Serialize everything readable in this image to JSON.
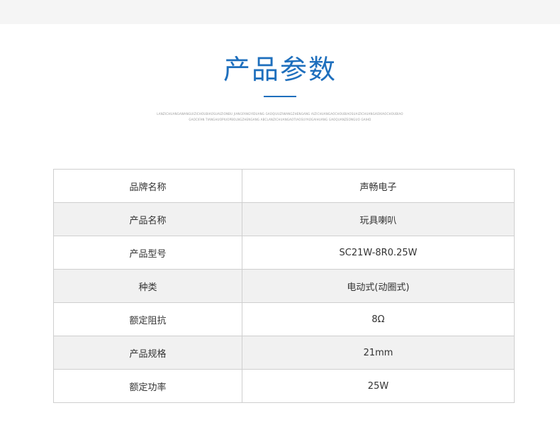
{
  "header": {
    "title": "产品参数",
    "subtitle_line_1": "LANZICHUANGAWANGUIZICHOUBIAOSUAIZIONBU JIANGFANGYIDUANG GAOQIUUZIWANGZHENGANG AIZICHUANGAOCHOUBIAOSUAIZICHUANGAOXIAOCHOUBIAO",
    "subtitle_line_2": "GAOCIFAN TIANGHUOPIUOPBOLNGZHENGANG ABCLANZICHUANGAOTIAOSUYAOGAIHUANG GAOQUANZEONGUO GAIHD"
  },
  "table": {
    "rows": [
      {
        "label": "品牌名称",
        "value": "声畅电子"
      },
      {
        "label": "产品名称",
        "value": "玩具喇叭"
      },
      {
        "label": "产品型号",
        "value": "SC21W-8R0.25W"
      },
      {
        "label": "种类",
        "value": "电动式(动圈式)"
      },
      {
        "label": "额定阻抗",
        "value": "8Ω"
      },
      {
        "label": "产品规格",
        "value": "21mm"
      },
      {
        "label": "额定功率",
        "value": "25W"
      }
    ]
  },
  "colors": {
    "accent": "#1e6fbd",
    "border": "#cfcfcf",
    "shade": "#f1f1f1"
  }
}
